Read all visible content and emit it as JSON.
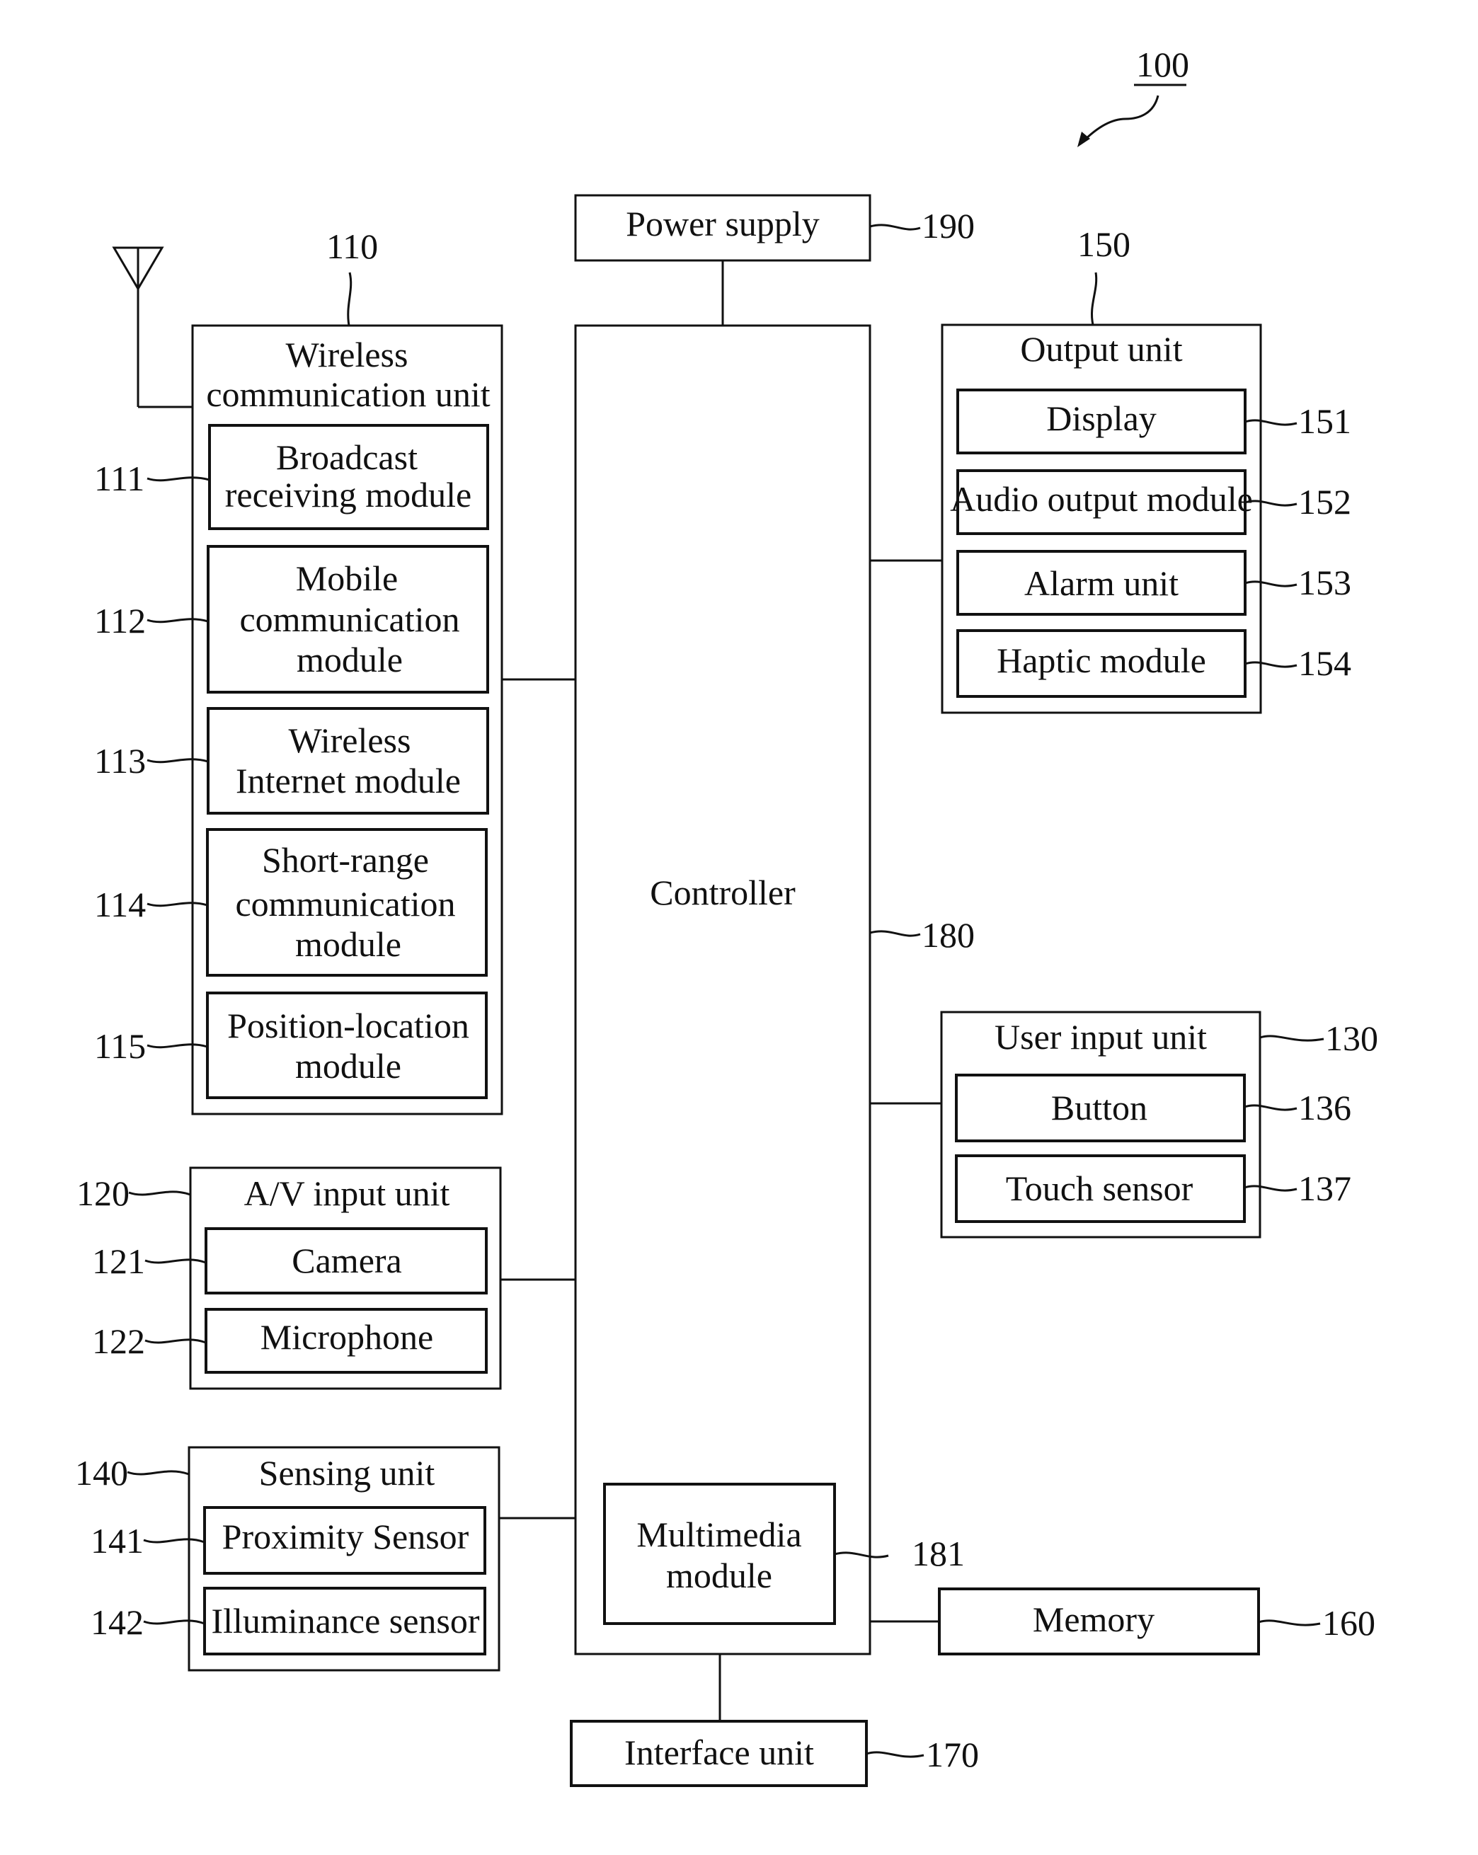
{
  "figure": {
    "ref": "100",
    "blocks": {
      "power_supply": {
        "label": "Power supply",
        "ref": "190"
      },
      "controller": {
        "label": "Controller",
        "ref": "180"
      },
      "multimedia": {
        "label_lines": [
          "Multimedia",
          "module"
        ],
        "ref": "181"
      },
      "memory": {
        "label": "Memory",
        "ref": "160"
      },
      "interface": {
        "label": "Interface unit",
        "ref": "170"
      },
      "wireless": {
        "label_lines": [
          "Wireless",
          "communication unit"
        ],
        "ref": "110",
        "items": [
          {
            "lines": [
              "Broadcast",
              "receiving module"
            ],
            "ref": "111"
          },
          {
            "lines": [
              "Mobile",
              "communication",
              "module"
            ],
            "ref": "112"
          },
          {
            "lines": [
              "Wireless",
              "Internet module"
            ],
            "ref": "113"
          },
          {
            "lines": [
              "Short-range",
              "communication",
              "module"
            ],
            "ref": "114"
          },
          {
            "lines": [
              "Position-location",
              "module"
            ],
            "ref": "115"
          }
        ]
      },
      "av_input": {
        "label": "A/V input unit",
        "ref": "120",
        "items": [
          {
            "label": "Camera",
            "ref": "121"
          },
          {
            "label": "Microphone",
            "ref": "122"
          }
        ]
      },
      "sensing": {
        "label": "Sensing unit",
        "ref": "140",
        "items": [
          {
            "label": "Proximity Sensor",
            "ref": "141"
          },
          {
            "label": "Illuminance sensor",
            "ref": "142"
          }
        ]
      },
      "output": {
        "label": "Output unit",
        "ref": "150",
        "items": [
          {
            "label": "Display",
            "ref": "151"
          },
          {
            "label": "Audio output module",
            "ref": "152"
          },
          {
            "label": "Alarm  unit",
            "ref": "153"
          },
          {
            "label": "Haptic module",
            "ref": "154"
          }
        ]
      },
      "user_input": {
        "label": "User input unit",
        "ref": "130",
        "items": [
          {
            "label": "Button",
            "ref": "136"
          },
          {
            "label": "Touch sensor",
            "ref": "137"
          }
        ]
      }
    }
  }
}
